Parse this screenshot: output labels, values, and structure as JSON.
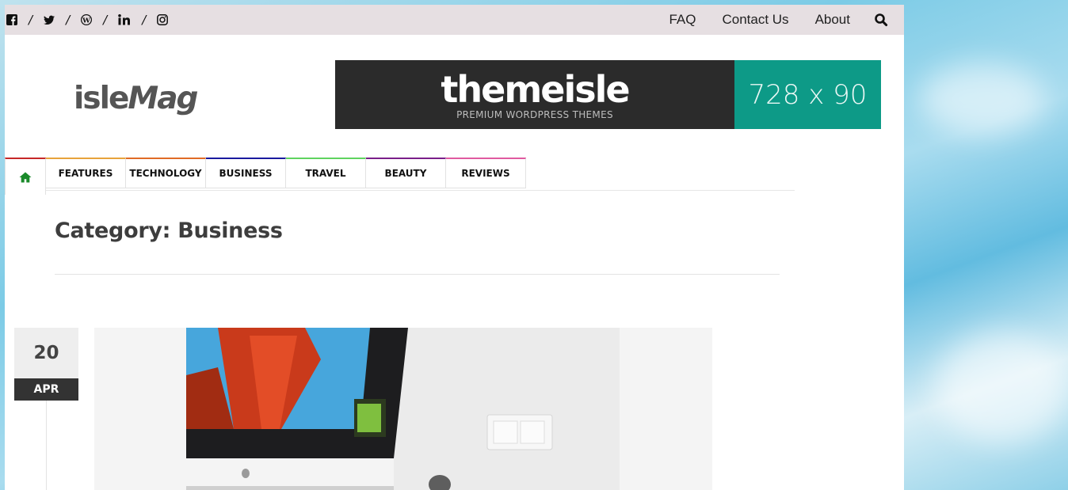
{
  "topbar": {
    "social_icons": [
      "facebook-icon",
      "twitter-icon",
      "wordpress-icon",
      "linkedin-icon",
      "instagram-icon"
    ],
    "separator": "/",
    "links": [
      "FAQ",
      "Contact Us",
      "About"
    ],
    "search_icon": "search-icon"
  },
  "header": {
    "logo_part1": "isle",
    "logo_part2": "Mag",
    "banner": {
      "brand": "themeisle",
      "tagline": "PREMIUM WORDPRESS THEMES",
      "size": "728 x 90"
    }
  },
  "nav": {
    "home_icon": "home-icon",
    "items": [
      {
        "label": "FEATURES",
        "color": "#e8a33b"
      },
      {
        "label": "TECHNOLOGY",
        "color": "#e06b25"
      },
      {
        "label": "BUSINESS",
        "color": "#1a1a9e"
      },
      {
        "label": "TRAVEL",
        "color": "#5fd35f"
      },
      {
        "label": "BEAUTY",
        "color": "#7a1f8a"
      },
      {
        "label": "REVIEWS",
        "color": "#e05aa0"
      }
    ],
    "home_color": "#c62828"
  },
  "category": {
    "title": "Category: Business"
  },
  "post": {
    "day": "20",
    "month": "APR"
  },
  "colors": {
    "topbar_bg": "#e6dfe2",
    "banner_dark": "#2b2b2b",
    "banner_teal": "#0d9a87",
    "home_icon": "#1a8a2a"
  }
}
